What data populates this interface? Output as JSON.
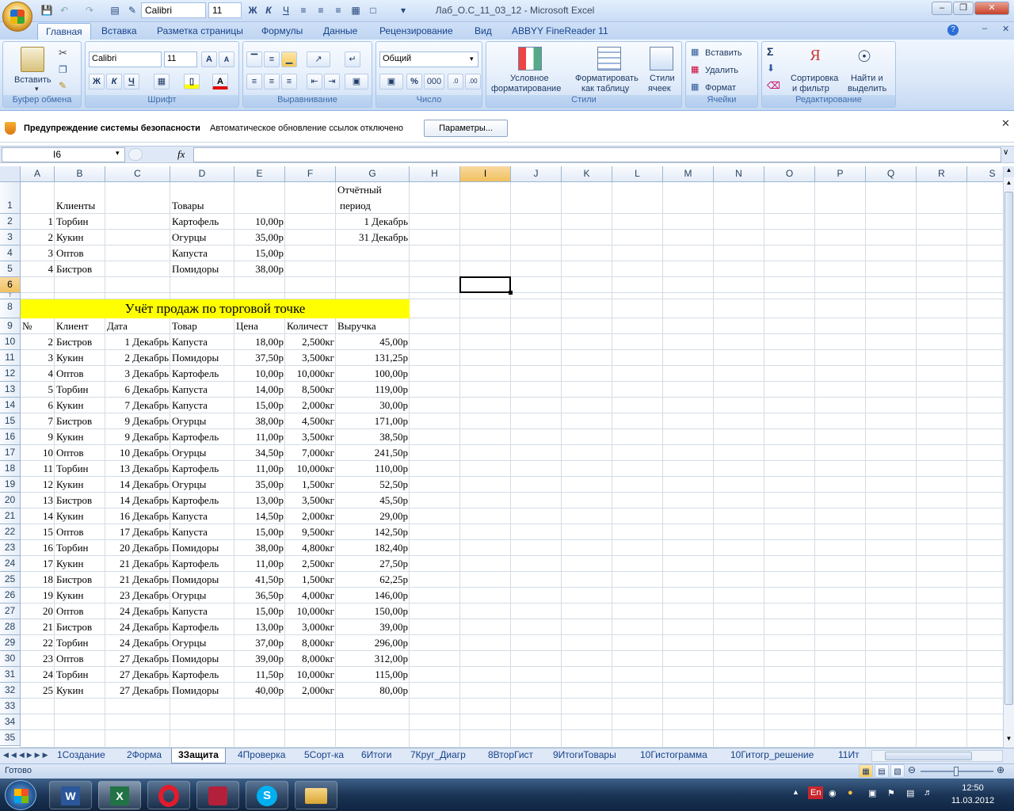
{
  "window": {
    "title": "Лаб_О.С_11_03_12 - Microsoft Excel",
    "font_name": "Calibri",
    "font_size": "11"
  },
  "tabs": [
    "Главная",
    "Вставка",
    "Разметка страницы",
    "Формулы",
    "Данные",
    "Рецензирование",
    "Вид",
    "ABBYY FineReader 11"
  ],
  "ribbon": {
    "clipboard": {
      "label": "Буфер обмена",
      "paste": "Вставить"
    },
    "font": {
      "label": "Шрифт",
      "name": "Calibri",
      "size": "11",
      "bold": "Ж",
      "italic": "К",
      "underline": "Ч"
    },
    "alignment": {
      "label": "Выравнивание"
    },
    "number": {
      "label": "Число",
      "format": "Общий",
      "percent": "%",
      "thousands": "000"
    },
    "styles": {
      "label": "Стили",
      "cond_format": "Условное",
      "cond_format2": "форматирование",
      "as_table": "Форматировать",
      "as_table2": "как таблицу",
      "cell_styles": "Стили",
      "cell_styles2": "ячеек"
    },
    "cells": {
      "label": "Ячейки",
      "insert": "Вставить",
      "delete": "Удалить",
      "format": "Формат"
    },
    "editing": {
      "label": "Редактирование",
      "sort": "Сортировка",
      "sort2": "и фильтр",
      "find": "Найти и",
      "find2": "выделить"
    }
  },
  "security": {
    "title": "Предупреждение системы безопасности",
    "message": "Автоматическое обновление ссылок отключено",
    "button": "Параметры..."
  },
  "formula_bar": {
    "name_box": "I6",
    "fx": "fx",
    "content": ""
  },
  "grid": {
    "columns": [
      "A",
      "B",
      "C",
      "D",
      "E",
      "F",
      "G",
      "H",
      "I",
      "J",
      "K",
      "L",
      "M",
      "N",
      "O",
      "P",
      "Q",
      "R",
      "S"
    ],
    "selected_column": "I",
    "selected_row": "6",
    "rows": [
      "1",
      "2",
      "3",
      "4",
      "5",
      "6",
      "7",
      "8",
      "9",
      "10",
      "11",
      "12",
      "13",
      "14",
      "15",
      "16",
      "17",
      "18",
      "19",
      "20",
      "21",
      "22",
      "23",
      "24",
      "25",
      "26",
      "27",
      "28",
      "29",
      "30",
      "31",
      "32",
      "33",
      "34",
      "35"
    ],
    "top": {
      "clients_label": "Клиенты",
      "goods_label": "Товары",
      "period_line1": "Отчётный",
      "period_line2": "период",
      "period_from": "1 Декабрь",
      "period_to": "31 Декабрь",
      "clients": [
        [
          "1",
          "Торбин",
          "Картофель",
          "10,00р"
        ],
        [
          "2",
          "Кукин",
          "Огурцы",
          "35,00р"
        ],
        [
          "3",
          "Оптов",
          "Капуста",
          "15,00р"
        ],
        [
          "4",
          "Бистров",
          "Помидоры",
          "38,00р"
        ]
      ]
    },
    "banner": "Учёт продаж по торговой точке",
    "headers": [
      "№",
      "Клиент",
      "Дата",
      "Товар",
      "Цена",
      "Количест",
      "Выручка"
    ],
    "sales": [
      [
        "2",
        "Бистров",
        "1 Декабрь",
        "Капуста",
        "18,00р",
        "2,500кг",
        "45,00р"
      ],
      [
        "3",
        "Кукин",
        "2 Декабрь",
        "Помидоры",
        "37,50р",
        "3,500кг",
        "131,25р"
      ],
      [
        "4",
        "Оптов",
        "3 Декабрь",
        "Картофель",
        "10,00р",
        "10,000кг",
        "100,00р"
      ],
      [
        "5",
        "Торбин",
        "6 Декабрь",
        "Капуста",
        "14,00р",
        "8,500кг",
        "119,00р"
      ],
      [
        "6",
        "Кукин",
        "7 Декабрь",
        "Капуста",
        "15,00р",
        "2,000кг",
        "30,00р"
      ],
      [
        "7",
        "Бистров",
        "9 Декабрь",
        "Огурцы",
        "38,00р",
        "4,500кг",
        "171,00р"
      ],
      [
        "9",
        "Кукин",
        "9 Декабрь",
        "Картофель",
        "11,00р",
        "3,500кг",
        "38,50р"
      ],
      [
        "10",
        "Оптов",
        "10 Декабрь",
        "Огурцы",
        "34,50р",
        "7,000кг",
        "241,50р"
      ],
      [
        "11",
        "Торбин",
        "13 Декабрь",
        "Картофель",
        "11,00р",
        "10,000кг",
        "110,00р"
      ],
      [
        "12",
        "Кукин",
        "14 Декабрь",
        "Огурцы",
        "35,00р",
        "1,500кг",
        "52,50р"
      ],
      [
        "13",
        "Бистров",
        "14 Декабрь",
        "Картофель",
        "13,00р",
        "3,500кг",
        "45,50р"
      ],
      [
        "14",
        "Кукин",
        "16 Декабрь",
        "Капуста",
        "14,50р",
        "2,000кг",
        "29,00р"
      ],
      [
        "15",
        "Оптов",
        "17 Декабрь",
        "Капуста",
        "15,00р",
        "9,500кг",
        "142,50р"
      ],
      [
        "16",
        "Торбин",
        "20 Декабрь",
        "Помидоры",
        "38,00р",
        "4,800кг",
        "182,40р"
      ],
      [
        "17",
        "Кукин",
        "21 Декабрь",
        "Картофель",
        "11,00р",
        "2,500кг",
        "27,50р"
      ],
      [
        "18",
        "Бистров",
        "21 Декабрь",
        "Помидоры",
        "41,50р",
        "1,500кг",
        "62,25р"
      ],
      [
        "19",
        "Кукин",
        "23 Декабрь",
        "Огурцы",
        "36,50р",
        "4,000кг",
        "146,00р"
      ],
      [
        "20",
        "Оптов",
        "24 Декабрь",
        "Капуста",
        "15,00р",
        "10,000кг",
        "150,00р"
      ],
      [
        "21",
        "Бистров",
        "24 Декабрь",
        "Картофель",
        "13,00р",
        "3,000кг",
        "39,00р"
      ],
      [
        "22",
        "Торбин",
        "24 Декабрь",
        "Огурцы",
        "37,00р",
        "8,000кг",
        "296,00р"
      ],
      [
        "23",
        "Оптов",
        "27 Декабрь",
        "Помидоры",
        "39,00р",
        "8,000кг",
        "312,00р"
      ],
      [
        "24",
        "Торбин",
        "27 Декабрь",
        "Картофель",
        "11,50р",
        "10,000кг",
        "115,00р"
      ],
      [
        "25",
        "Кукин",
        "27 Декабрь",
        "Помидоры",
        "40,00р",
        "2,000кг",
        "80,00р"
      ]
    ]
  },
  "sheet_tabs": [
    "1Создание",
    "2Форма",
    "3Защита",
    "4Проверка",
    "5Сорт-ка",
    "6Итоги",
    "7Круг_Диагр",
    "8ВторГист",
    "9ИтогиТовары",
    "10Гистограмма",
    "10Гитогр_решение",
    "11Ит"
  ],
  "active_sheet": "3Защита",
  "status": {
    "ready": "Готово"
  },
  "taskbar": {
    "lang": "En",
    "time": "12:50",
    "date": "11.03.2012"
  }
}
